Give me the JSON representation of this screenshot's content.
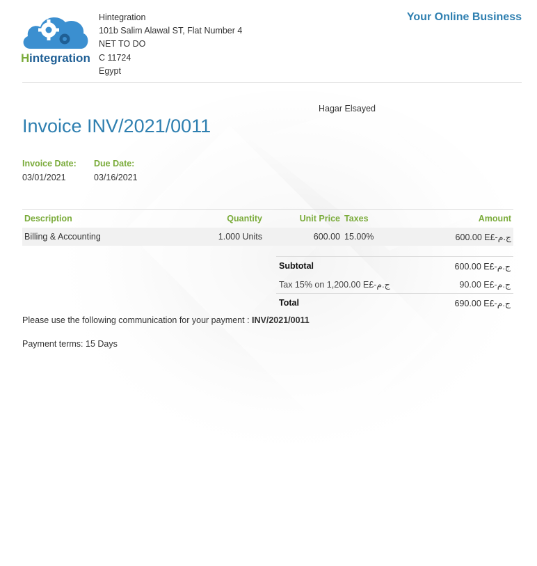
{
  "company": {
    "logo_text_h": "H",
    "logo_text_rest": "integration",
    "name": "Hintegration",
    "address_line1": "101b Salim Alawal ST, Flat Number 4",
    "address_line2": "NET TO DO",
    "address_line3": "C 11724",
    "country": "Egypt",
    "tagline": "Your Online Business"
  },
  "customer": {
    "name": "Hagar Elsayed"
  },
  "invoice": {
    "title": "Invoice INV/2021/0011",
    "date_label": "Invoice Date:",
    "date_value": "03/01/2021",
    "due_label": "Due Date:",
    "due_value": "03/16/2021"
  },
  "table": {
    "headers": {
      "description": "Description",
      "quantity": "Quantity",
      "unit_price": "Unit Price",
      "taxes": "Taxes",
      "amount": "Amount"
    },
    "rows": [
      {
        "description": "Billing & Accounting",
        "quantity": "1.000 Units",
        "unit_price": "600.00",
        "taxes": "15.00%",
        "amount": "600.00 E£-ج.م"
      }
    ]
  },
  "totals": {
    "subtotal_label": "Subtotal",
    "subtotal_value": "600.00 E£-ج.م",
    "tax_label": "Tax 15% on 1,200.00 E£-ج.م",
    "tax_value": "90.00 E£-ج.م",
    "total_label": "Total",
    "total_value": "690.00 E£-ج.م"
  },
  "payment": {
    "communication_text": "Please use the following communication for your payment :",
    "communication_ref": "INV/2021/0011",
    "terms": "Payment terms: 15 Days"
  },
  "colors": {
    "blue": "#2e7fb0",
    "green": "#7aab3a",
    "row_bg": "#f1f1f1"
  }
}
